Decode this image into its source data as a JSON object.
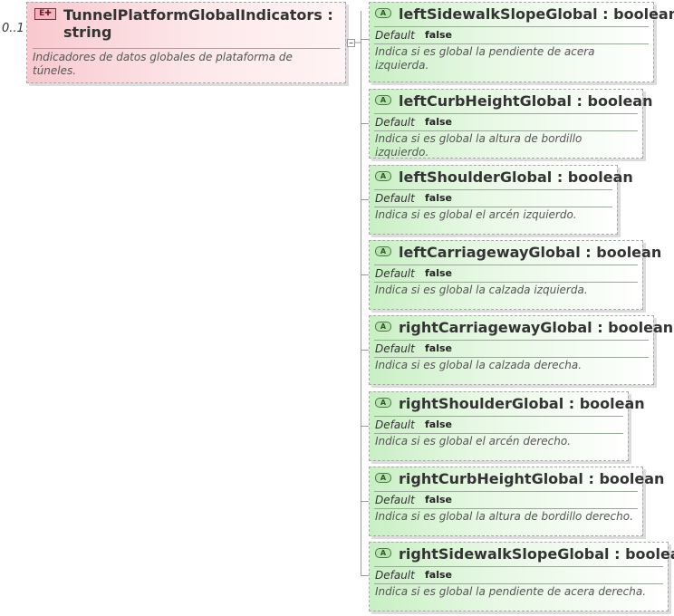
{
  "element": {
    "badge": "E",
    "title": "TunnelPlatformGlobalIndicators : string",
    "multiplicity": "0..1",
    "description": "Indicadores de datos globales de plataforma de túneles."
  },
  "attributes": [
    {
      "badge": "A",
      "title": "leftSidewalkSlopeGlobal : boolean",
      "default_label": "Default",
      "default_value": "false",
      "description": "Indica si es global la pendiente de acera izquierda."
    },
    {
      "badge": "A",
      "title": "leftCurbHeightGlobal : boolean",
      "default_label": "Default",
      "default_value": "false",
      "description": "Indica si es global la altura de bordillo izquierdo."
    },
    {
      "badge": "A",
      "title": "leftShoulderGlobal : boolean",
      "default_label": "Default",
      "default_value": "false",
      "description": "Indica si es global el arcén izquierdo."
    },
    {
      "badge": "A",
      "title": "leftCarriagewayGlobal : boolean",
      "default_label": "Default",
      "default_value": "false",
      "description": "Indica si es global la calzada izquierda."
    },
    {
      "badge": "A",
      "title": "rightCarriagewayGlobal : boolean",
      "default_label": "Default",
      "default_value": "false",
      "description": "Indica si es global la calzada derecha."
    },
    {
      "badge": "A",
      "title": "rightShoulderGlobal : boolean",
      "default_label": "Default",
      "default_value": "false",
      "description": "Indica si es global el arcén derecho."
    },
    {
      "badge": "A",
      "title": "rightCurbHeightGlobal : boolean",
      "default_label": "Default",
      "default_value": "false",
      "description": "Indica si es global la altura de bordillo derecho."
    },
    {
      "badge": "A",
      "title": "rightSidewalkSlopeGlobal : boolean",
      "default_label": "Default",
      "default_value": "false",
      "description": "Indica si es global la pendiente de acera derecha."
    }
  ]
}
